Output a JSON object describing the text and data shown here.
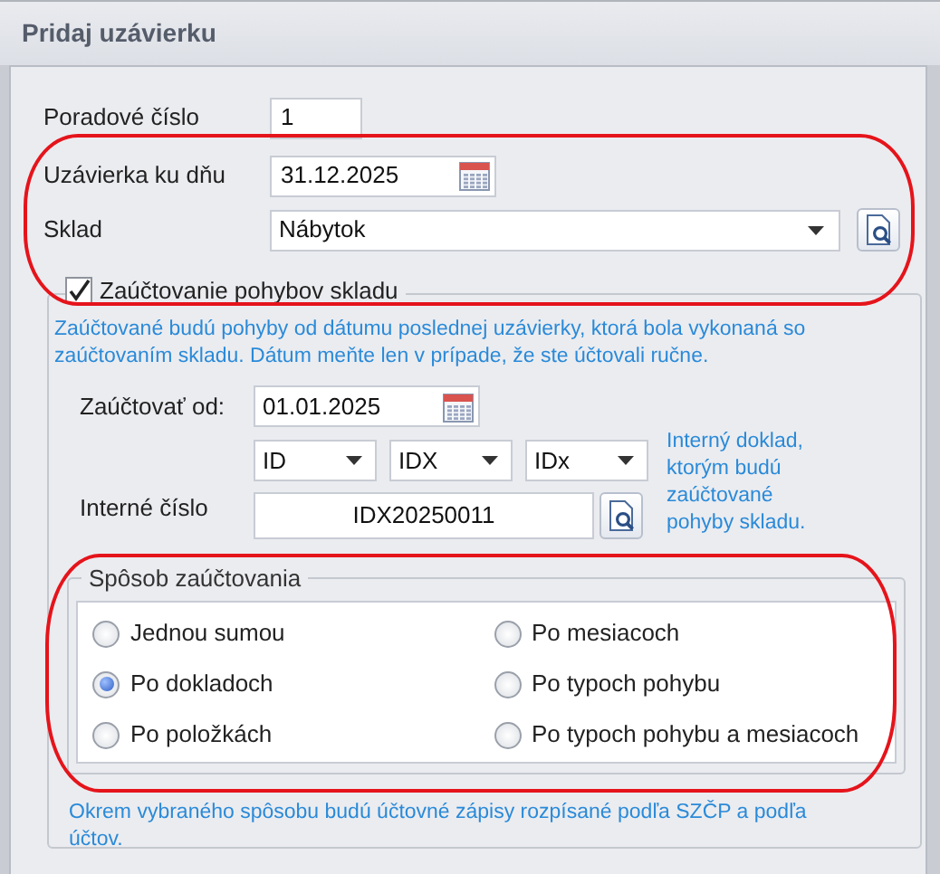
{
  "window": {
    "title": "Pridaj uzávierku"
  },
  "order": {
    "label": "Poradové číslo",
    "value": "1"
  },
  "closing_date": {
    "label": "Uzávierka ku dňu",
    "value": "31.12.2025"
  },
  "warehouse": {
    "label": "Sklad",
    "value": "Nábytok"
  },
  "posting": {
    "label": "Zaúčtovanie pohybov skladu",
    "checked": true,
    "info": "Zaúčtované budú pohyby od dátumu poslednej uzávierky, ktorá bola vykonaná so zaúčtovaním skladu. Dátum meňte len v prípade, že ste účtovali ručne.",
    "from": {
      "label": "Zaúčtovať od:",
      "value": "01.01.2025"
    },
    "series": [
      "ID",
      "IDX",
      "IDx"
    ],
    "doc_hint": "Interný doklad, ktorým budú zaúčtované pohyby skladu.",
    "internal": {
      "label": "Interné číslo",
      "value": "IDX20250011"
    },
    "method": {
      "title": "Spôsob zaúčtovania",
      "options": [
        {
          "label": "Jednou sumou",
          "selected": false
        },
        {
          "label": "Po dokladoch",
          "selected": true
        },
        {
          "label": "Po položkách",
          "selected": false
        },
        {
          "label": "Po mesiacoch",
          "selected": false
        },
        {
          "label": "Po typoch pohybu",
          "selected": false
        },
        {
          "label": "Po typoch pohybu a mesiacoch",
          "selected": false
        }
      ]
    },
    "note": "Okrem vybraného spôsobu budú účtovné zápisy rozpísané podľa SZČP a podľa účtov."
  }
}
